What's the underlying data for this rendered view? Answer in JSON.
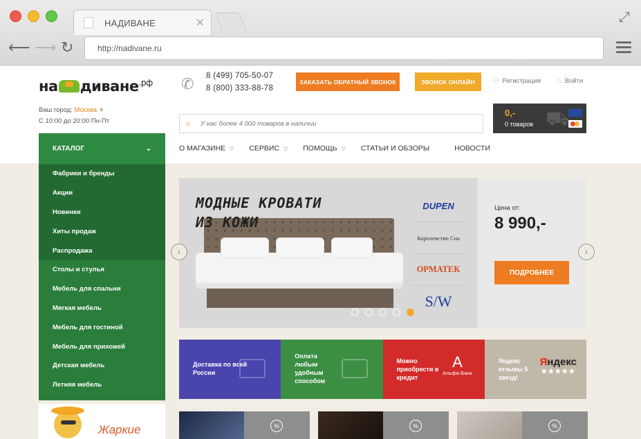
{
  "browser": {
    "tab_title": "НАДИВАНЕ",
    "url": "http://nadivane.ru"
  },
  "header": {
    "logo_left": "на",
    "logo_right": "диване",
    "logo_suffix": ".рф",
    "city_label": "Ваш город:",
    "city_value": "Москва",
    "hours": "С 10:00 до 20:00 Пн-Пт",
    "phone1": "8 (499) 705-50-07",
    "phone2": "8 (800) 333-88-78",
    "callback_button": "ЗАКАЗАТЬ ОБРАТНЫЙ ЗВОНОК",
    "online_button": "ЗВОНОК ОНЛАЙН",
    "register": "Регистрация",
    "login": "Войти",
    "search_placeholder": "У нас более 4 000 товаров в наличии",
    "cart_price": "0,-",
    "cart_count": "0 товаров",
    "nav": [
      "О МАГАЗИНЕ",
      "СЕРВИС",
      "ПОМОЩЬ",
      "СТАТЬИ И ОБЗОРЫ",
      "НОВОСТИ"
    ]
  },
  "catalog": {
    "title": "КАТАЛОГ",
    "top_items": [
      "Фабрики и бренды",
      "Акции",
      "Новинки",
      "Хиты продаж",
      "Распродажа"
    ],
    "items": [
      "Столы и стулья",
      "Мебель для спальни",
      "Мягкая мебель",
      "Мебель для гостиной",
      "Мебель для прихожей",
      "Детская мебель",
      "Летняя мебель"
    ]
  },
  "promo": {
    "text": "Жаркие"
  },
  "banner": {
    "headline_line1": "МОДНЫЕ КРОВАТИ",
    "headline_line2": "ИЗ КОЖИ",
    "brands": [
      "DUPEN",
      "Королевство Сна",
      "ОРМАТЕК",
      "S/W"
    ],
    "price_label": "Цена от:",
    "price_value": "8 990,-",
    "more_button": "ПОДРОБНЕЕ",
    "slide_count": 5,
    "active_slide": 5
  },
  "tiles": {
    "delivery": "Доставка по всей России",
    "payment": "Оплата любым удобным способом",
    "credit": "Можно приобрести в кредит",
    "credit_bank": "Альфа-Банк",
    "credit_logo": "А",
    "yandex": "Яндекс отзывы 5 звезд!",
    "yandex_logo_first": "Я",
    "yandex_logo_rest": "ндекс",
    "yandex_stars": "★★★★★"
  },
  "products": {
    "discount_symbol": "%"
  }
}
